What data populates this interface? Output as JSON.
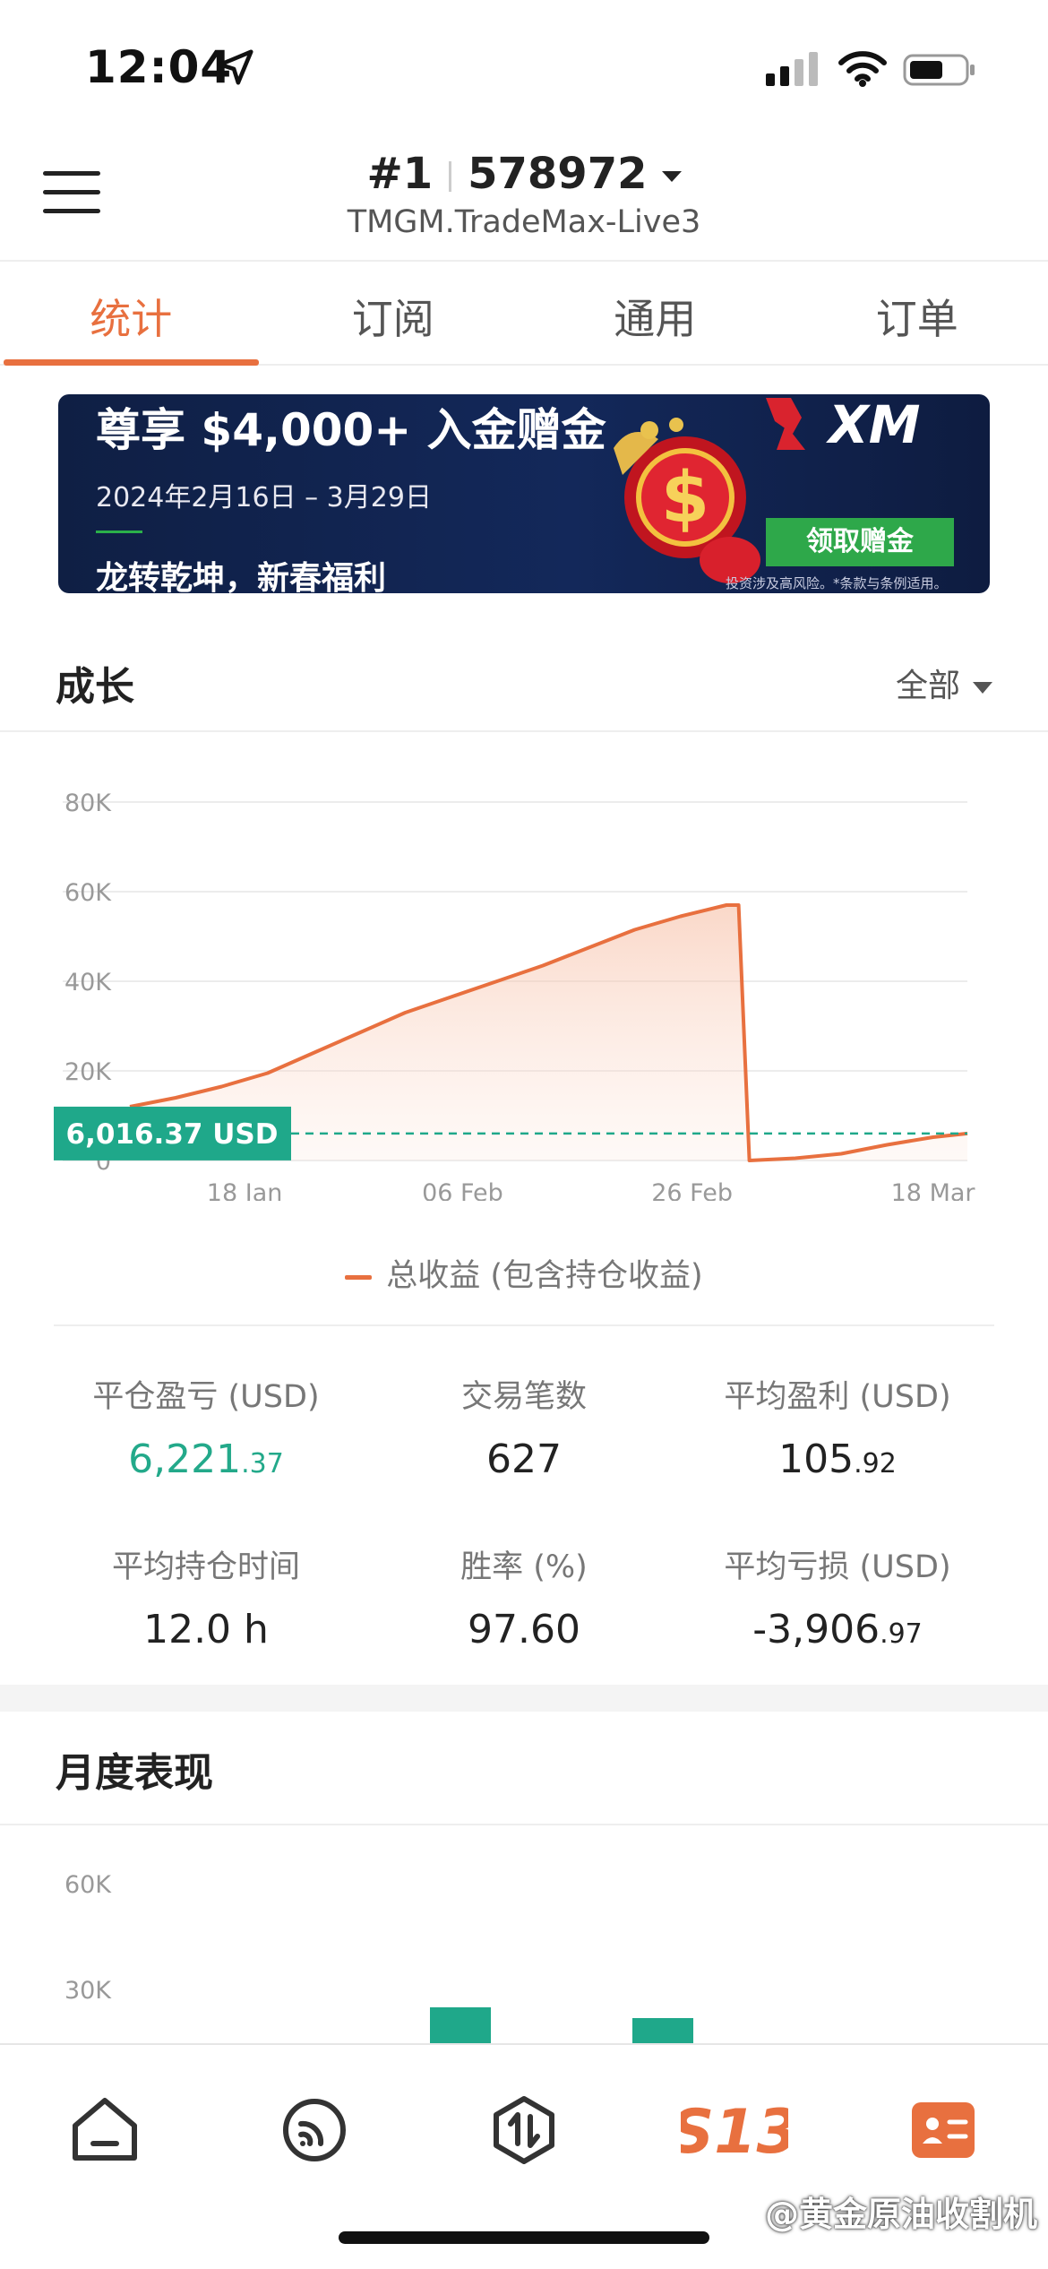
{
  "status_bar": {
    "time": "12:04"
  },
  "header": {
    "account_prefix": "#1",
    "account_number": "578972",
    "server": "TMGM.TradeMax-Live3"
  },
  "tabs": [
    {
      "label": "统计",
      "active": true
    },
    {
      "label": "订阅",
      "active": false
    },
    {
      "label": "通用",
      "active": false
    },
    {
      "label": "订单",
      "active": false
    }
  ],
  "banner": {
    "title": "尊享 $4,000+ 入金赠金",
    "date_range": "2024年2月16日 – 3月29日",
    "subtitle": "龙转乾坤，新春福利",
    "brand": "XM",
    "cta": "领取赠金",
    "disclaimer": "投资涉及高风险。*条款与条例适用。"
  },
  "growth": {
    "title": "成长",
    "filter": "全部",
    "current_value_label": "6,016.37 USD",
    "legend": "总收益 (包含持仓收益)"
  },
  "chart_data": {
    "type": "line",
    "title": "",
    "xlabel": "",
    "ylabel": "",
    "y_ticks": [
      "0",
      "20K",
      "40K",
      "60K",
      "80K"
    ],
    "ylim": [
      0,
      80000
    ],
    "x_ticks": [
      "18 Jan",
      "06 Feb",
      "26 Feb",
      "18 Mar"
    ],
    "series": [
      {
        "name": "总收益 (包含持仓收益)",
        "color": "#e8703f",
        "x": [
          "2024-01-08",
          "2024-01-12",
          "2024-01-16",
          "2024-01-20",
          "2024-01-24",
          "2024-01-28",
          "2024-02-01",
          "2024-02-05",
          "2024-02-09",
          "2024-02-13",
          "2024-02-17",
          "2024-02-21",
          "2024-02-25",
          "2024-02-29",
          "2024-03-02",
          "2024-03-06",
          "2024-03-10",
          "2024-03-14",
          "2024-03-18",
          "2024-03-21"
        ],
        "values": [
          12000,
          14000,
          16500,
          19500,
          24000,
          28500,
          33000,
          36500,
          40000,
          43500,
          47500,
          51500,
          54500,
          57000,
          0,
          500,
          1500,
          3500,
          5200,
          6016.37
        ]
      }
    ],
    "reference_line": {
      "value": 6016.37,
      "label": "6,016.37 USD",
      "style": "dashed",
      "color": "#1fa88a"
    },
    "grid": true
  },
  "stats": [
    {
      "label": "平仓盈亏 (USD)",
      "int": "6,221",
      "dec": ".37",
      "color": "green"
    },
    {
      "label": "交易笔数",
      "int": "627",
      "dec": "",
      "color": "default"
    },
    {
      "label": "平均盈利 (USD)",
      "int": "105",
      "dec": ".92",
      "color": "default"
    },
    {
      "label": "平均持仓时间",
      "int": "12.0 h",
      "dec": "",
      "color": "default"
    },
    {
      "label": "胜率 (%)",
      "int": "97.60",
      "dec": "",
      "color": "default"
    },
    {
      "label": "平均亏损 (USD)",
      "int": "-3,906",
      "dec": ".97",
      "color": "default"
    }
  ],
  "monthly": {
    "title": "月度表现",
    "y_ticks": [
      "30K",
      "60K"
    ],
    "bars_color": "#1fa88a"
  },
  "bottom_nav": {
    "items": [
      "home-icon",
      "signal-icon",
      "trade-icon",
      "s13-logo-icon",
      "account-card-icon"
    ],
    "brand_mark": "S13"
  },
  "watermark": "@黄金原油收割机",
  "colors": {
    "accent": "#e8703f",
    "green": "#1fa88a"
  }
}
